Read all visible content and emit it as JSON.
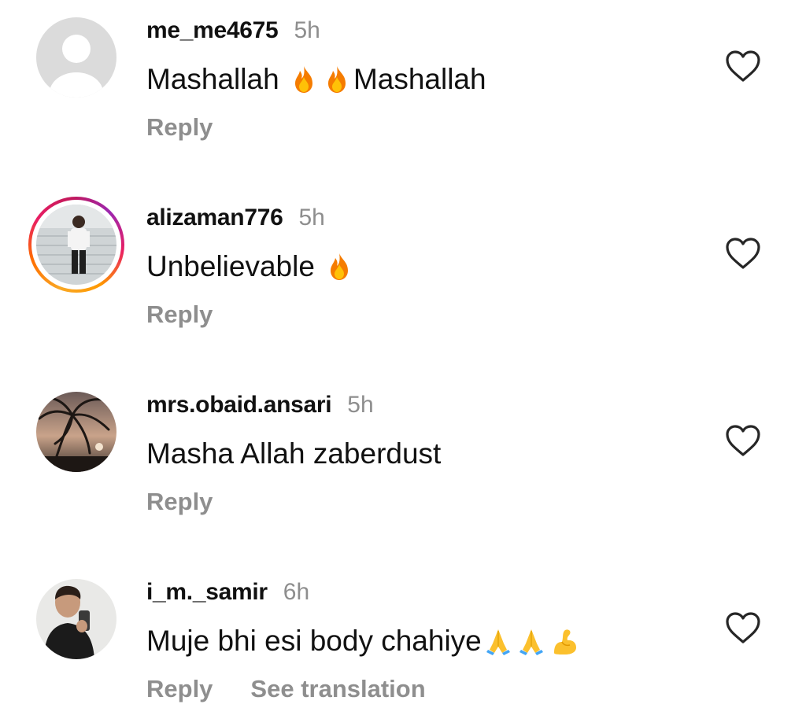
{
  "comments": [
    {
      "username": "me_me4675",
      "time": "5h",
      "text_parts": [
        "Mashallah ",
        "Mashallah"
      ],
      "reply_label": "Reply"
    },
    {
      "username": "alizaman776",
      "time": "5h",
      "text_parts": [
        "Unbelievable "
      ],
      "reply_label": "Reply"
    },
    {
      "username": "mrs.obaid.ansari",
      "time": "5h",
      "text_parts": [
        "Masha Allah zaberdust"
      ],
      "reply_label": "Reply"
    },
    {
      "username": "i_m._samir",
      "time": "6h",
      "text_parts": [
        "Muje bhi esi body chahiye"
      ],
      "reply_label": "Reply",
      "see_translation_label": "See translation"
    }
  ],
  "icons": {
    "like": "heart-outline-icon",
    "fire": "fire-emoji-icon",
    "pray": "folded-hands-emoji-icon",
    "muscle": "flexed-biceps-emoji-icon"
  },
  "colors": {
    "text": "#111111",
    "muted": "#8e8e8e",
    "story_ring_start": "#f9a825",
    "story_ring_end": "#c2185b"
  }
}
